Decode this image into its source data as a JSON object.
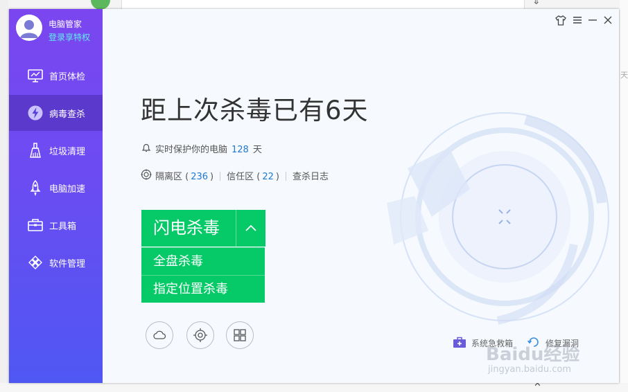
{
  "profile": {
    "name": "电脑管家",
    "vip_label": "登录享特权"
  },
  "nav": [
    {
      "id": "home",
      "label": "首页体检",
      "icon": "monitor-icon"
    },
    {
      "id": "virus",
      "label": "病毒查杀",
      "icon": "lightning-icon",
      "active": true
    },
    {
      "id": "clean",
      "label": "垃圾清理",
      "icon": "broom-icon"
    },
    {
      "id": "speed",
      "label": "电脑加速",
      "icon": "rocket-icon"
    },
    {
      "id": "tools",
      "label": "工具箱",
      "icon": "toolbox-icon"
    },
    {
      "id": "software",
      "label": "软件管理",
      "icon": "software-icon"
    }
  ],
  "main": {
    "headline": "距上次杀毒已有6天",
    "protect": {
      "text": "实时保护你的电脑",
      "days": "128",
      "unit": "天"
    },
    "zones": {
      "quarantine_label": "隔离区 (",
      "quarantine_count": "236",
      "quarantine_close": ")",
      "trust_label": "信任区 (",
      "trust_count": "22",
      "trust_close": ")",
      "log_label": "查杀日志"
    },
    "scan_button": "闪电杀毒",
    "scan_options": [
      "全盘杀毒",
      "指定位置杀毒"
    ],
    "tools": {
      "rescue": "系统急救箱",
      "repair": "修复漏洞"
    }
  },
  "colors": {
    "accent_green": "#06c968",
    "sidebar_top": "#7b46f0",
    "sidebar_bottom": "#4f57f3",
    "link_blue": "#1e79d6"
  },
  "background": {
    "right_edge_text": "天",
    "watermark_main": "Baidu经验",
    "watermark_url": "jingyan.baidu.com"
  }
}
